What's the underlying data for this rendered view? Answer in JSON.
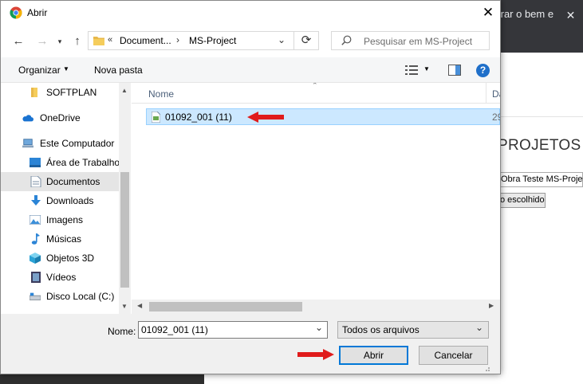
{
  "background": {
    "tab_title": "trar o bem e",
    "heading": "PROJETOS",
    "select_value": "Obra Teste MS-Project",
    "file_button": "o escolhido"
  },
  "dialog": {
    "title": "Abrir",
    "address": {
      "chevron": "«",
      "segment1": "Document...",
      "separator": "›",
      "segment2": "MS-Project"
    },
    "search": {
      "placeholder": "Pesquisar em MS-Project"
    },
    "commands": {
      "organize": "Organizar",
      "new_folder": "Nova pasta"
    },
    "nav_items": [
      {
        "label": "SOFTPLAN",
        "icon": "folder-icon"
      },
      {
        "label": "OneDrive",
        "icon": "cloud-icon"
      },
      {
        "label": "Este Computador",
        "icon": "computer-icon"
      },
      {
        "label": "Área de Trabalho",
        "icon": "desktop-icon"
      },
      {
        "label": "Documentos",
        "icon": "documents-icon"
      },
      {
        "label": "Downloads",
        "icon": "download-icon"
      },
      {
        "label": "Imagens",
        "icon": "pictures-icon"
      },
      {
        "label": "Músicas",
        "icon": "music-icon"
      },
      {
        "label": "Objetos 3D",
        "icon": "cube-icon"
      },
      {
        "label": "Vídeos",
        "icon": "video-icon"
      },
      {
        "label": "Disco Local (C:)",
        "icon": "drive-icon"
      }
    ],
    "columns": {
      "name": "Nome",
      "date": "Da"
    },
    "files": [
      {
        "name": "01092_001 (11)",
        "date": "29"
      }
    ],
    "bottom": {
      "name_label": "Nome:",
      "name_value": "01092_001 (11)",
      "type_value": "Todos os arquivos",
      "open_label": "Abrir",
      "cancel_label": "Cancelar"
    },
    "colors": {
      "accent": "#0078d7",
      "selection": "#cce8ff",
      "annotation": "#e01b1b"
    }
  }
}
